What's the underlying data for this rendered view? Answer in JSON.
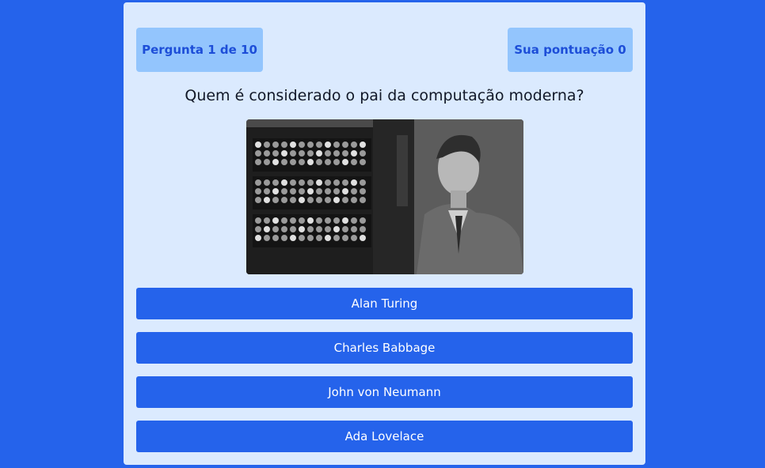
{
  "header": {
    "question_counter": "Pergunta 1 de 10",
    "score": "Sua pontuação 0"
  },
  "question": {
    "text": "Quem é considerado o pai da computação moderna?"
  },
  "answers": [
    {
      "label": "Alan Turing"
    },
    {
      "label": "Charles Babbage"
    },
    {
      "label": "John von Neumann"
    },
    {
      "label": "Ada Lovelace"
    }
  ],
  "colors": {
    "background": "#2563eb",
    "card": "#dbeafe",
    "badge": "#93c5fd",
    "badge_text": "#1d4ed8",
    "answer_button": "#2563eb"
  }
}
